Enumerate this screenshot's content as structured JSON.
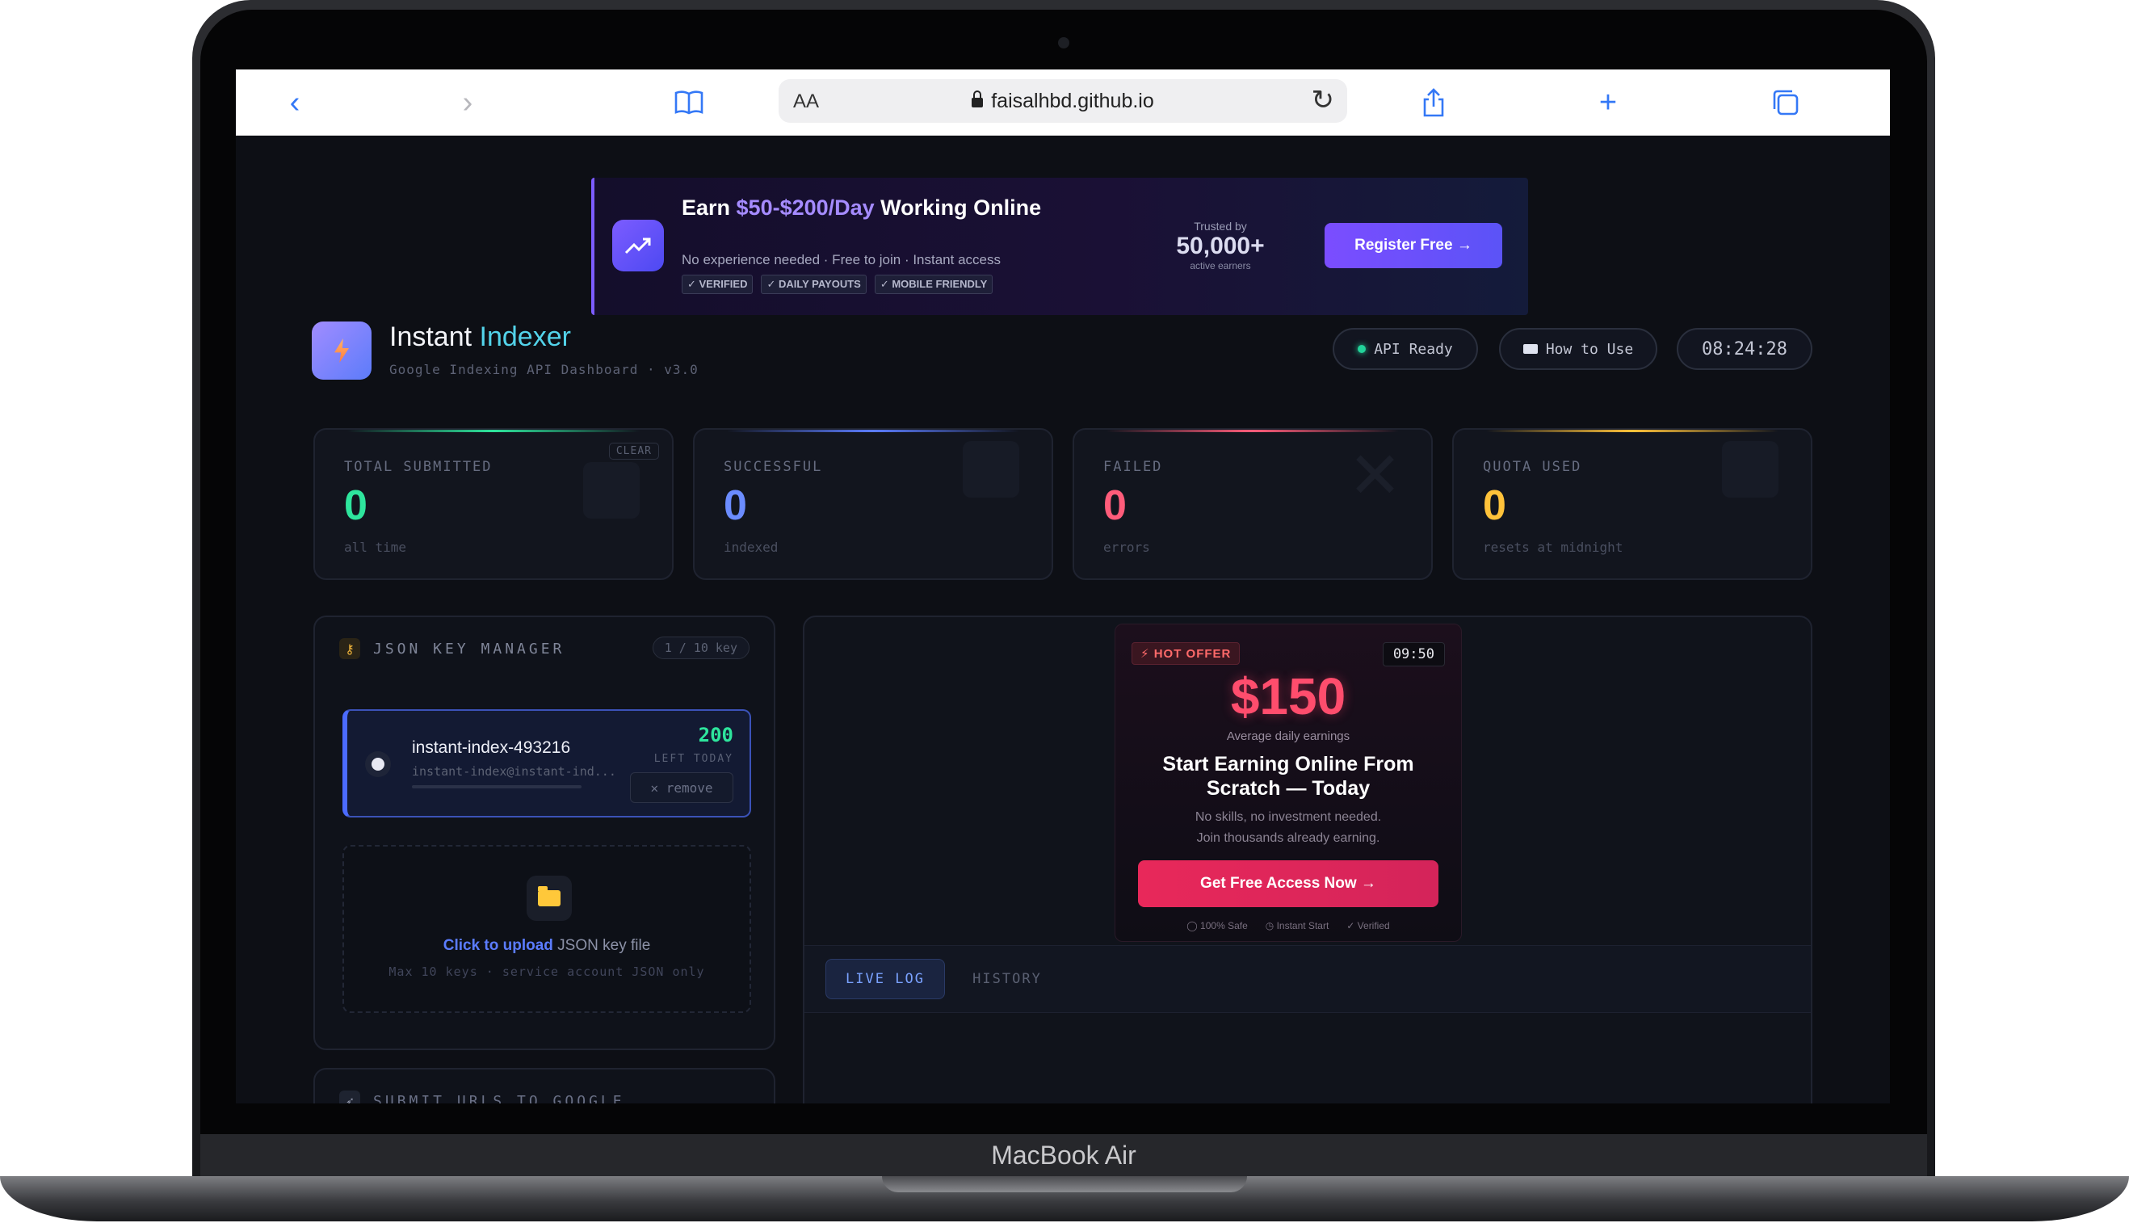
{
  "device": {
    "label": "MacBook Air"
  },
  "browser": {
    "text_size_label": "AA",
    "url": "faisalhbd.github.io"
  },
  "banner_ad": {
    "title_pre": "Earn ",
    "title_highlight": "$50-$200/Day",
    "title_post": " Working Online",
    "subtitle": "No experience needed · Free to join · Instant access",
    "tags": [
      "✓ VERIFIED",
      "✓ DAILY PAYOUTS",
      "✓ MOBILE FRIENDLY"
    ],
    "trusted_label": "Trusted by",
    "trusted_count": "50,000+",
    "trusted_sub": "active earners",
    "cta": "Register Free →"
  },
  "header": {
    "title_main": "Instant ",
    "title_accent": "Indexer",
    "subtitle": "Google Indexing API Dashboard · v3.0",
    "api_status": "API Ready",
    "how_to_use": "How to Use",
    "clock": "08:24:28"
  },
  "stats": [
    {
      "label": "TOTAL SUBMITTED",
      "value": "0",
      "sub": "all time",
      "color": "#2ee59d",
      "line": "#2ee59d"
    },
    {
      "label": "SUCCESSFUL",
      "value": "0",
      "sub": "indexed",
      "color": "#6b8cff",
      "line": "#5b7cff"
    },
    {
      "label": "FAILED",
      "value": "0",
      "sub": "errors",
      "color": "#ff5c7a",
      "line": "#ff5c7a"
    },
    {
      "label": "QUOTA USED",
      "value": "0",
      "sub": "resets at midnight",
      "color": "#ffc23a",
      "line": "#ffc23a"
    }
  ],
  "stats_clear": "CLEAR",
  "key_manager": {
    "title": "JSON KEY MANAGER",
    "count": "1 / 10 key",
    "key": {
      "name": "instant-index-493216",
      "email": "instant-index@instant-ind...",
      "remaining": "200",
      "remaining_label": "LEFT TODAY",
      "remove": "✕ remove"
    },
    "upload_link": "Click to upload",
    "upload_text": " JSON key file",
    "upload_hint": "Max 10 keys · service account JSON only"
  },
  "submit_panel": {
    "title": "SUBMIT URLS TO GOOGLE"
  },
  "offer_ad": {
    "badge": "⚡ HOT OFFER",
    "timer": "09:50",
    "price": "$150",
    "price_sub": "Average daily earnings",
    "title": "Start Earning Online From Scratch — Today",
    "desc_line1": "No skills, no investment needed.",
    "desc_line2": "Join thousands already earning.",
    "cta": "Get Free Access Now →",
    "foot": [
      "100% Safe",
      "Instant Start",
      "Verified"
    ]
  },
  "log_tabs": {
    "live": "LIVE LOG",
    "history": "HISTORY"
  }
}
